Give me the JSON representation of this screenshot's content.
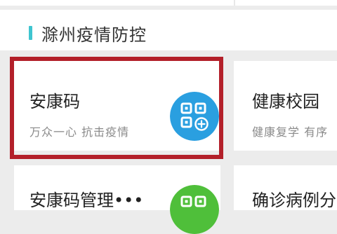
{
  "section": {
    "title": "滁州疫情防控"
  },
  "cards": [
    {
      "title": "安康码",
      "subtitle": "万众一心 抗击疫情",
      "icon": "qr-code-icon",
      "icon_color": "#2a9fe0"
    },
    {
      "title": "健康校园",
      "subtitle": "健康复学 有序"
    },
    {
      "title": "安康码管理•••",
      "icon": "qr-code-icon",
      "icon_color": "#4fbf3a"
    },
    {
      "title": "确诊病例分"
    }
  ],
  "colors": {
    "accent_bar": "#3fc5d0",
    "highlight_border": "#b3202a"
  }
}
